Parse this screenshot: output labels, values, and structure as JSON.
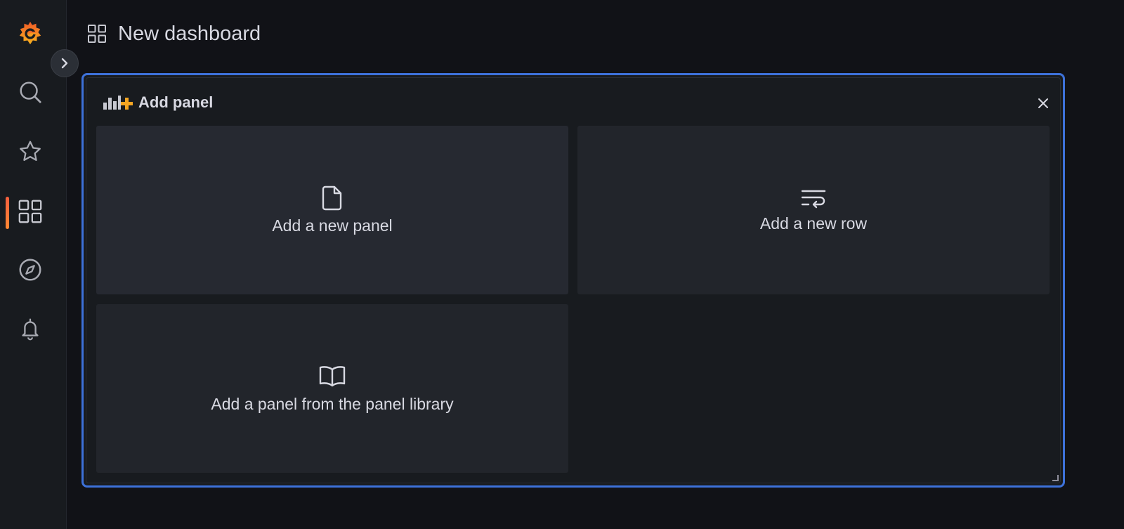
{
  "header": {
    "title": "New dashboard",
    "icon": "apps-icon"
  },
  "sidenav": {
    "items": [
      {
        "name": "grafana-logo",
        "icon": "grafana-logo-icon"
      },
      {
        "name": "search",
        "icon": "search-icon"
      },
      {
        "name": "starred",
        "icon": "star-icon"
      },
      {
        "name": "dashboards",
        "icon": "apps-icon",
        "active": true
      },
      {
        "name": "explore",
        "icon": "compass-icon"
      },
      {
        "name": "alerting",
        "icon": "bell-icon"
      }
    ],
    "expand_icon": "chevron-right-icon"
  },
  "add_panel": {
    "title": "Add panel",
    "options": [
      {
        "label": "Add a new panel",
        "icon": "file-icon"
      },
      {
        "label": "Add a new row",
        "icon": "wrap-text-icon"
      },
      {
        "label": "Add a panel from the panel library",
        "icon": "book-open-icon"
      }
    ]
  },
  "colors": {
    "background": "#111217",
    "sidenav": "#181b1f",
    "accent_border": "#3d71d9",
    "active_indicator": "#f55f3e",
    "brand_orange": "#f5a623"
  }
}
